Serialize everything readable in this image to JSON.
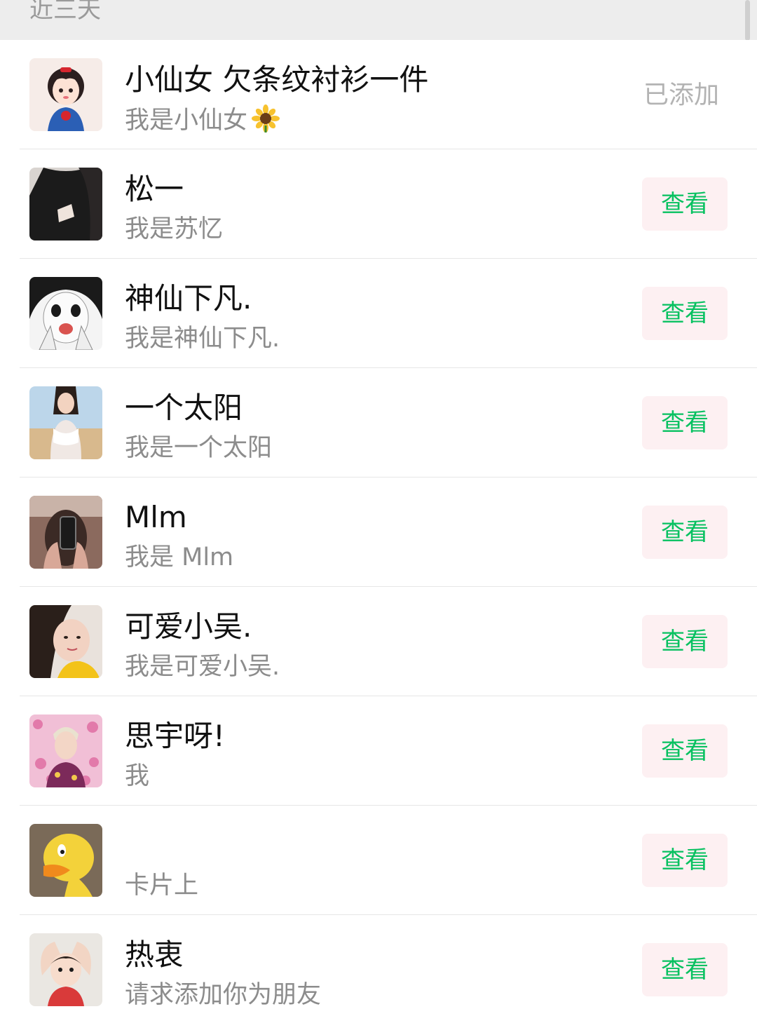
{
  "section": {
    "title": "近三天"
  },
  "rows": [
    {
      "name": "小仙女 欠条纹衬衫一件",
      "message": "我是小仙女",
      "emoji": "sunflower-icon",
      "action": "已添加",
      "action_type": "added"
    },
    {
      "name": "松一",
      "message": "我是苏忆",
      "action": "查看",
      "action_type": "view"
    },
    {
      "name": "神仙下凡.",
      "message": "我是神仙下凡.",
      "action": "查看",
      "action_type": "view"
    },
    {
      "name": "一个太阳",
      "message": "我是一个太阳",
      "action": "查看",
      "action_type": "view"
    },
    {
      "name": "Mlm",
      "message": "我是 Mlm",
      "action": "查看",
      "action_type": "view"
    },
    {
      "name": "可爱小吴.",
      "message": "我是可爱小吴.",
      "action": "查看",
      "action_type": "view"
    },
    {
      "name": "思宇呀!",
      "message": "我",
      "action": "查看",
      "action_type": "view"
    },
    {
      "name": "",
      "message": "卡片上",
      "action": "查看",
      "action_type": "view"
    },
    {
      "name": "热衷",
      "message": "请求添加你为朋友",
      "action": "查看",
      "action_type": "view"
    }
  ],
  "colors": {
    "accent_green": "#07c160",
    "button_bg": "#fdf0f2",
    "header_bg": "#ededed",
    "secondary_text": "#8c8c8c"
  }
}
